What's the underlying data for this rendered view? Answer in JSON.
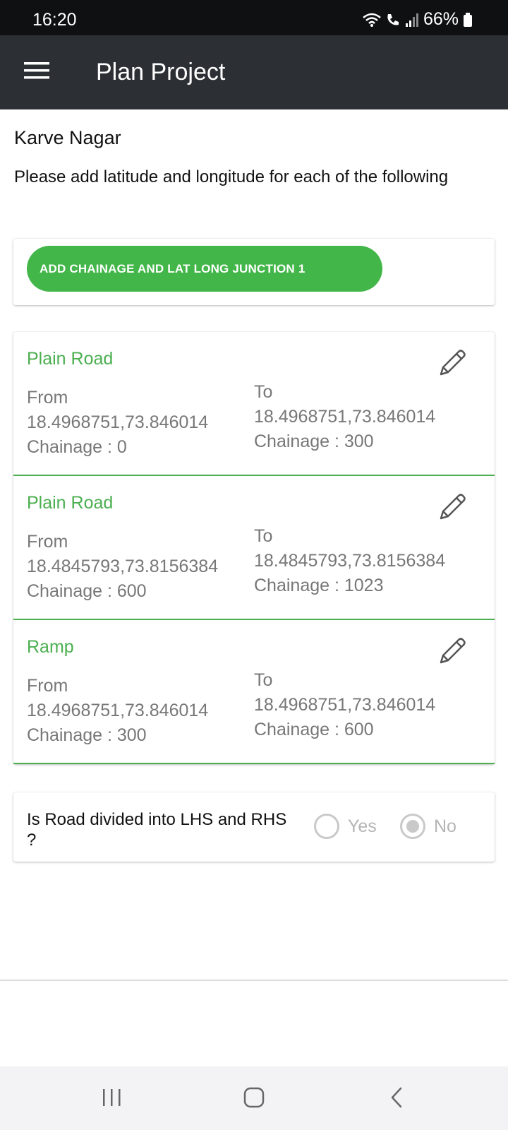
{
  "status_bar": {
    "time": "16:20",
    "battery": "66%",
    "icons": [
      "wifi-icon",
      "wifi-call-icon",
      "signal-icon",
      "battery-icon"
    ]
  },
  "app_bar": {
    "title": "Plan Project",
    "menu_icon": "hamburger-menu-icon"
  },
  "project": {
    "name": "Karve Nagar",
    "instructions": "Please add latitude and longitude for each of the following"
  },
  "add_button": {
    "label": "ADD CHAINAGE AND LAT LONG JUNCTION 1"
  },
  "segments": [
    {
      "type": "Plain Road",
      "from_label": "From",
      "from_coords": "18.4968751,73.846014",
      "from_chainage": "Chainage : 0",
      "to_label": "To",
      "to_coords": "18.4968751,73.846014",
      "to_chainage": "Chainage : 300"
    },
    {
      "type": "Plain Road",
      "from_label": "From",
      "from_coords": "18.4845793,73.8156384",
      "from_chainage": "Chainage : 600",
      "to_label": "To",
      "to_coords": "18.4845793,73.8156384",
      "to_chainage": "Chainage : 1023"
    },
    {
      "type": "Ramp",
      "from_label": "From",
      "from_coords": "18.4968751,73.846014",
      "from_chainage": "Chainage : 300",
      "to_label": "To",
      "to_coords": "18.4968751,73.846014",
      "to_chainage": "Chainage : 600"
    }
  ],
  "divided_question": {
    "label": "Is Road divided into LHS and RHS ?",
    "options": [
      {
        "label": "Yes",
        "selected": false
      },
      {
        "label": "No",
        "selected": true
      }
    ]
  },
  "colors": {
    "app_bar": "#2c2f34",
    "accent_green": "#43b649",
    "segment_title": "#4caf50",
    "muted_text": "#777777"
  },
  "nav_bar": {
    "icons": [
      "recents-icon",
      "home-icon",
      "back-icon"
    ]
  }
}
